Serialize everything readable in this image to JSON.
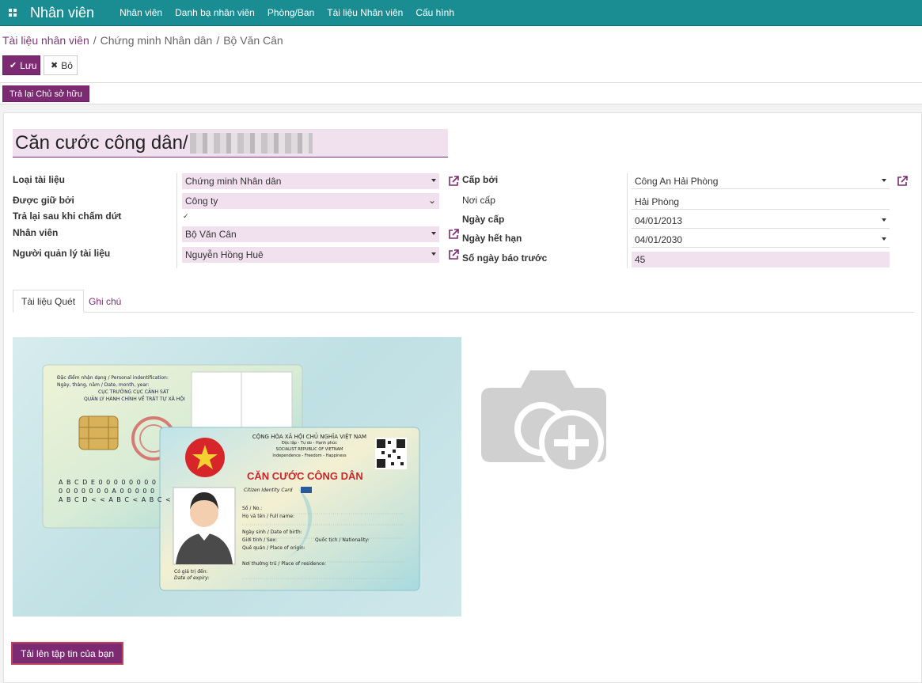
{
  "app": {
    "title": "Nhân viên"
  },
  "topmenu": [
    "Nhân viên",
    "Danh bạ nhân viên",
    "Phòng/Ban",
    "Tài liệu Nhân viên",
    "Cấu hình"
  ],
  "breadcrumb": {
    "root": "Tài liệu nhân viên",
    "mid": "Chứng minh Nhân dân",
    "current": "Bộ Văn Cân"
  },
  "actions": {
    "save": "Lưu",
    "discard": "Bỏ",
    "return_owner": "Trả lại Chủ sở hữu"
  },
  "doc_title": "Căn cước công dân/",
  "form": {
    "left": [
      {
        "label": "Loại tài liệu",
        "value": "Chứng minh Nhân dân"
      },
      {
        "label": "Được giữ bởi",
        "value": "Công ty"
      },
      {
        "label": "Trả lại sau khi chấm dứt",
        "checked": true
      },
      {
        "label": "Nhân viên",
        "value": "Bộ Văn Cân"
      },
      {
        "label": "Người quản lý tài liệu",
        "value": "Nguyễn Hồng Huê"
      }
    ],
    "right": [
      {
        "label": "Cấp bởi",
        "value": "Công An Hải Phòng"
      },
      {
        "label": "Nơi cấp",
        "value": "Hải Phòng"
      },
      {
        "label": "Ngày cấp",
        "value": "04/01/2013"
      },
      {
        "label": "Ngày hết hạn",
        "value": "04/01/2030"
      },
      {
        "label": "Số ngày báo trước",
        "value": "45"
      }
    ]
  },
  "tabs": [
    "Tài liệu Quét",
    "Ghi chú"
  ],
  "upload_button": "Tải lên tập tin của bạn",
  "card": {
    "back_lines": [
      "Đặc điểm nhận dạng / Personal indentification:",
      "Ngày, tháng, năm / Date, month, year:",
      "CỤC TRƯỞNG CỤC CẢNH SÁT",
      "QUẢN LÝ HÀNH CHÍNH VỀ TRẬT TỰ XÃ HỘI"
    ],
    "mrz": [
      "A B C D E 0 0 0 0 0 0 0 0",
      "0 0 0 0 0 0 0 A 0 0 0 0 0",
      "A B C D < < A B C < A B C <"
    ],
    "header1": "CỘNG HÒA XÃ HỘI CHỦ NGHĨA VIỆT NAM",
    "header2": "Độc lập - Tự do - Hạnh phúc",
    "header3": "SOCIALIST REPUBLIC OF VIETNAM",
    "header4": "Independence - Freedom - Happiness",
    "title": "CĂN CƯỚC CÔNG DÂN",
    "subtitle": "Citizen Identity Card",
    "fields": [
      "Số / No.:",
      "Họ và tên / Full name:",
      "Ngày sinh / Date of birth:",
      "Giới tính / Sex:",
      "Quốc tịch / Nationality:",
      "Quê quán / Place of origin:",
      "Nơi thường trú / Place of residence:"
    ],
    "expiry1": "Có giá trị đến:",
    "expiry2": "Date of expiry:"
  },
  "colors": {
    "navbar": "#1a8d93",
    "primary": "#7c2a72",
    "required_bg": "#f1e1ef"
  }
}
